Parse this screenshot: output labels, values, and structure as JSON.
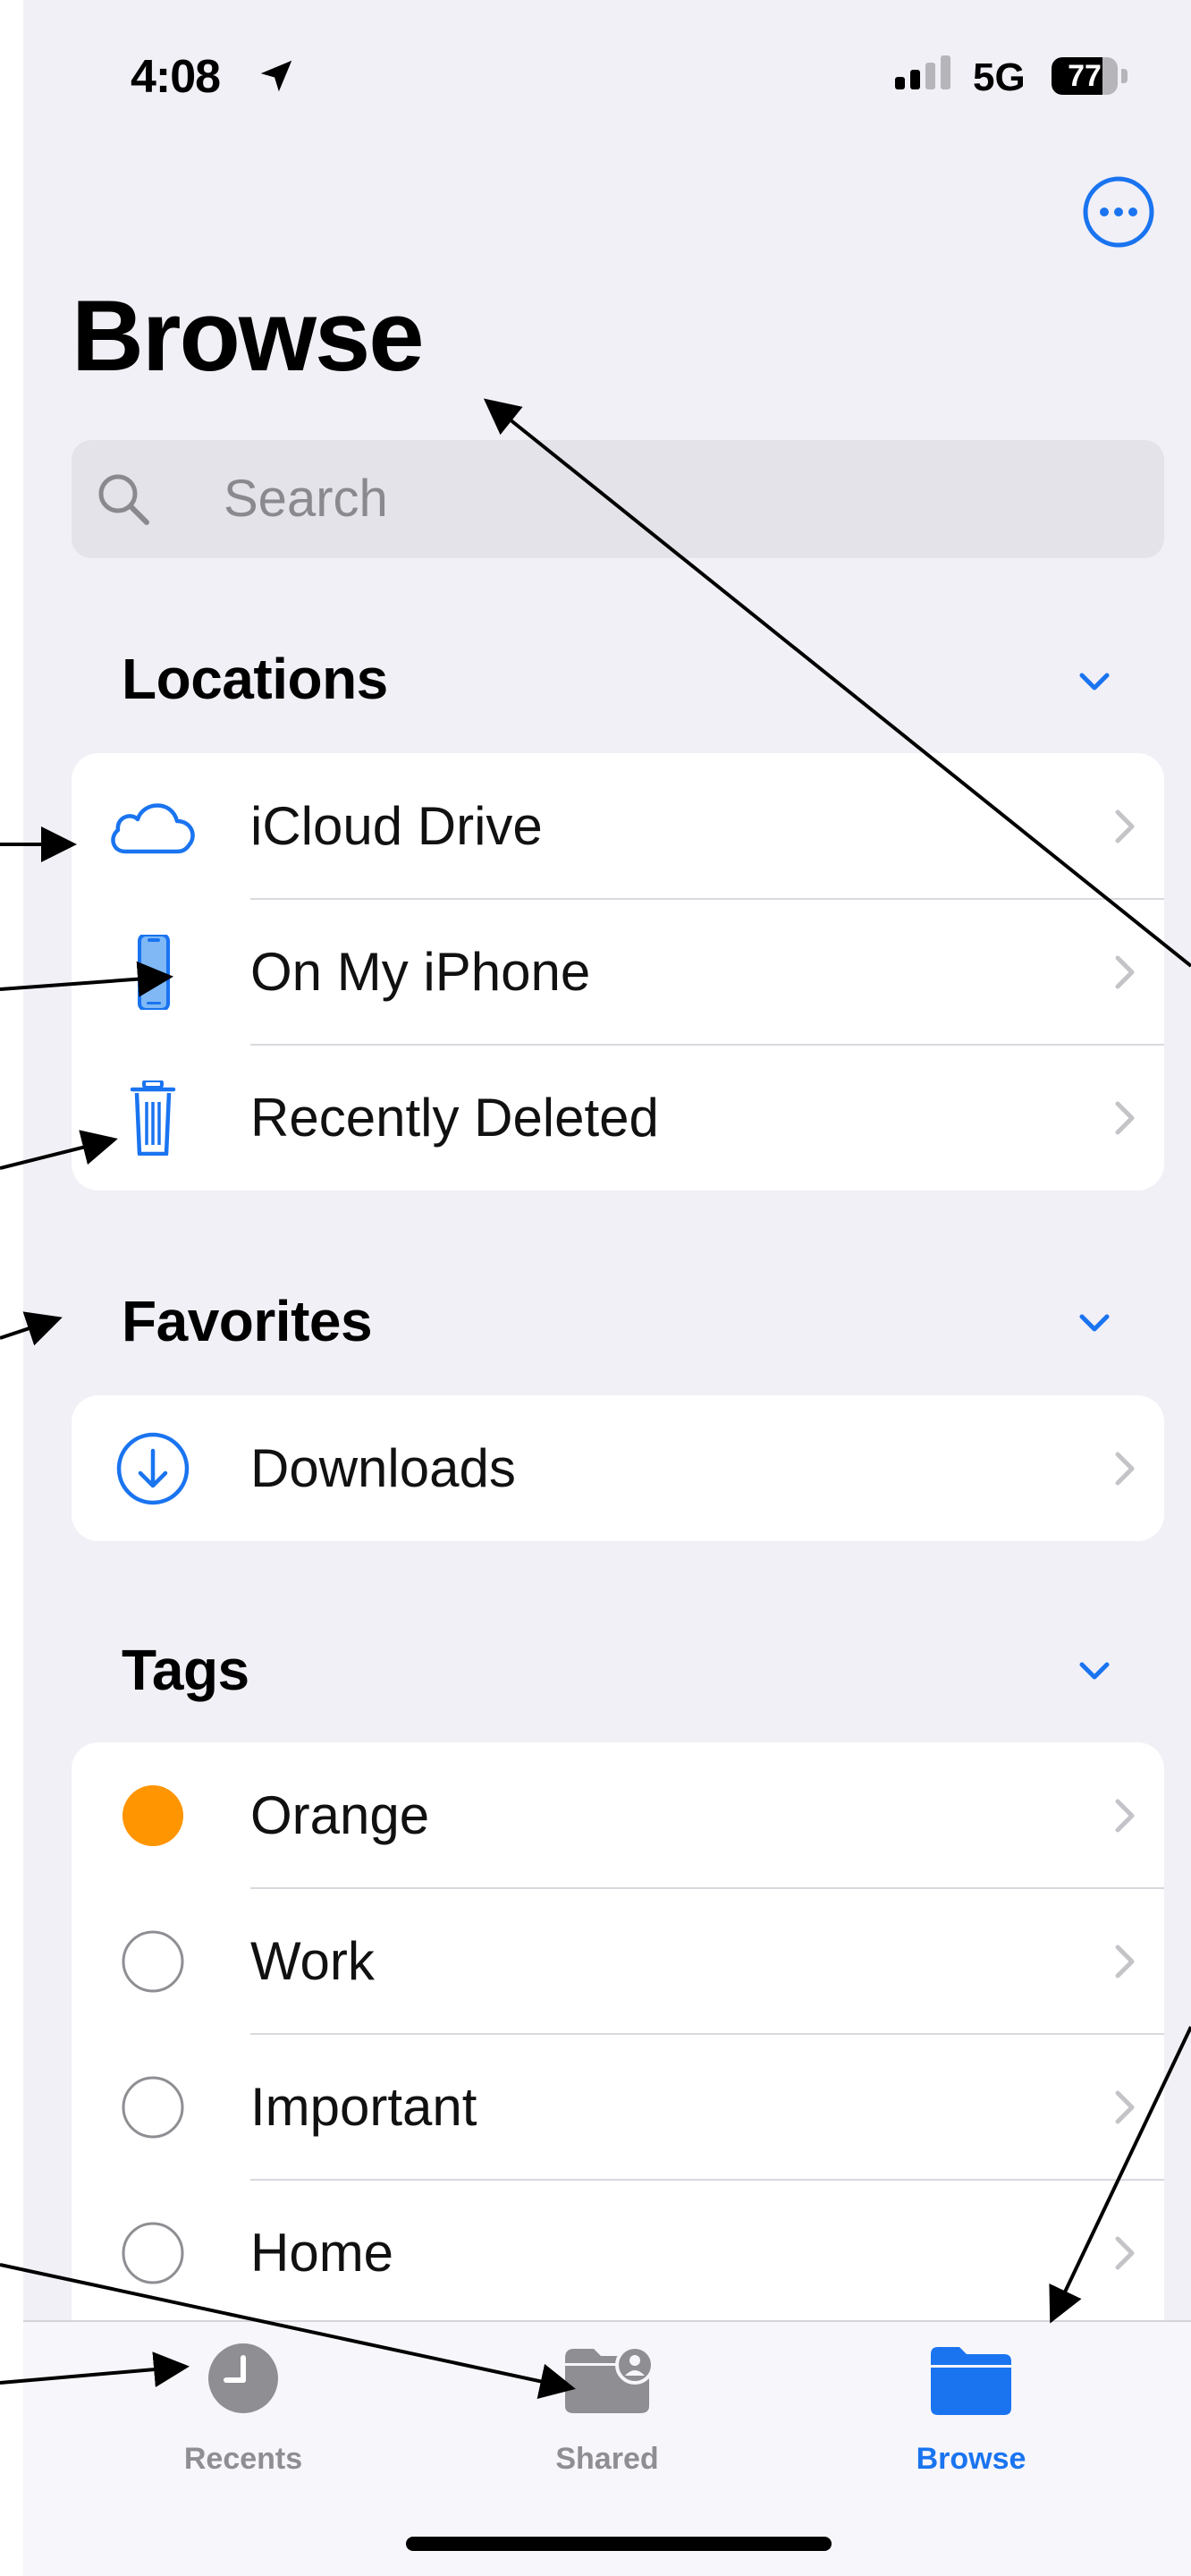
{
  "status_bar": {
    "time": "4:08",
    "network": "5G",
    "battery": "77",
    "battery_level": 0.77
  },
  "header": {
    "title": "Browse",
    "more_icon": "ellipsis-circle-icon"
  },
  "search": {
    "placeholder": "Search",
    "icon": "magnifying-glass-icon"
  },
  "sections": {
    "locations": {
      "title": "Locations",
      "items": [
        {
          "label": "iCloud Drive",
          "icon": "cloud-icon"
        },
        {
          "label": "On My iPhone",
          "icon": "iphone-icon"
        },
        {
          "label": "Recently Deleted",
          "icon": "trash-icon"
        }
      ]
    },
    "favorites": {
      "title": "Favorites",
      "items": [
        {
          "label": "Downloads",
          "icon": "download-circle-icon"
        }
      ]
    },
    "tags": {
      "title": "Tags",
      "items": [
        {
          "label": "Orange",
          "color": "#ff9500"
        },
        {
          "label": "Work",
          "color": "none"
        },
        {
          "label": "Important",
          "color": "none"
        },
        {
          "label": "Home",
          "color": "none"
        }
      ]
    }
  },
  "tab_bar": {
    "tabs": [
      {
        "label": "Recents",
        "icon": "clock-icon",
        "active": false
      },
      {
        "label": "Shared",
        "icon": "shared-folder-icon",
        "active": false
      },
      {
        "label": "Browse",
        "icon": "folder-icon",
        "active": true
      }
    ]
  },
  "colors": {
    "accent": "#1a74f0",
    "inactive": "#8e8e93",
    "background": "#f1f0f6",
    "orange_tag": "#ff9500"
  }
}
